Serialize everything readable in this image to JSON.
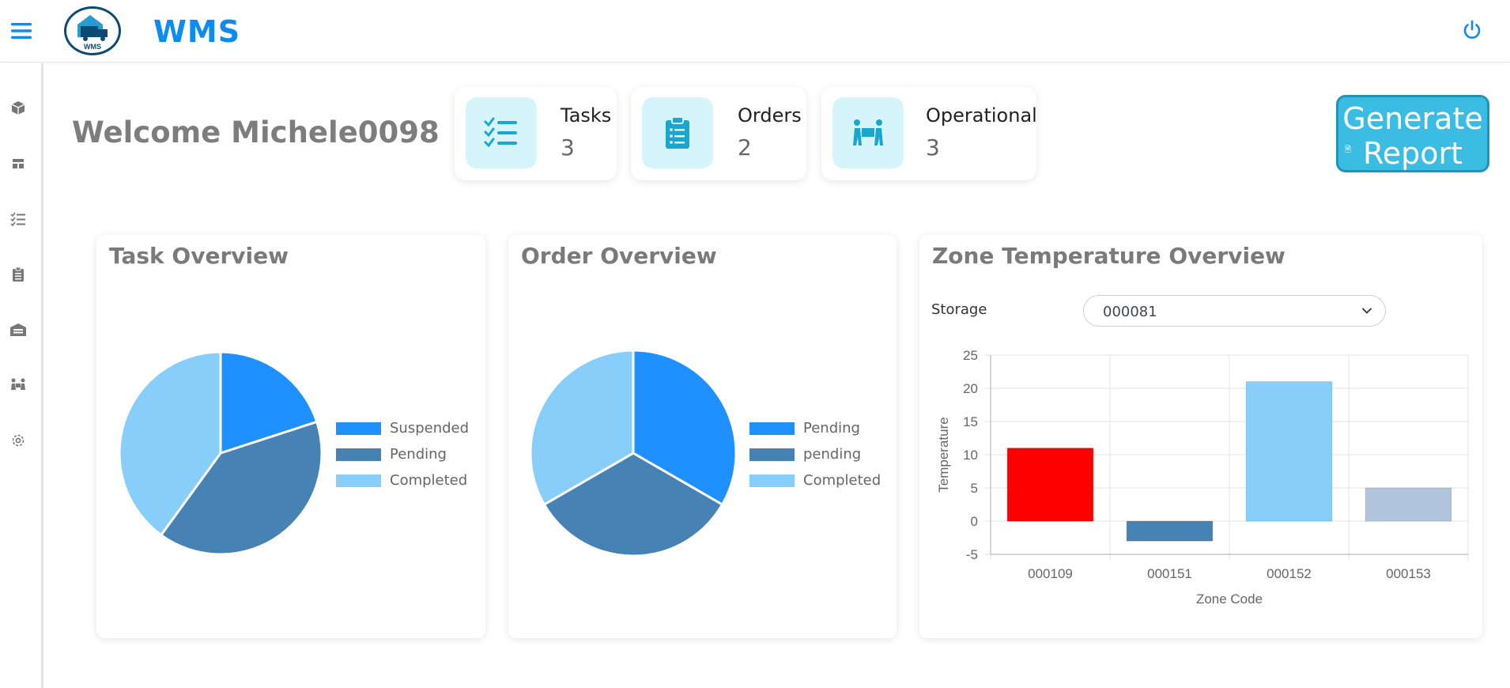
{
  "app": {
    "brand": "WMS",
    "logo_text": "WMS"
  },
  "header": {
    "menu_icon": "hamburger-icon",
    "power_icon": "power-icon",
    "accent": "#0d8bf2"
  },
  "sidebar": {
    "items": [
      {
        "icon": "box-icon"
      },
      {
        "icon": "layout-icon"
      },
      {
        "icon": "checklist-icon"
      },
      {
        "icon": "clipboard-icon"
      },
      {
        "icon": "warehouse-icon"
      },
      {
        "icon": "people-icon"
      },
      {
        "icon": "gear-icon"
      }
    ]
  },
  "welcome": "Welcome Michele0098",
  "stats": [
    {
      "label": "Tasks",
      "value": "3",
      "icon": "task-list-icon"
    },
    {
      "label": "Orders",
      "value": "2",
      "icon": "order-clipboard-icon"
    },
    {
      "label": "Operational",
      "value": "3",
      "icon": "workers-icon"
    }
  ],
  "generate_report": {
    "line1": "Generate",
    "line2": "Report"
  },
  "panels": {
    "task": {
      "title": "Task Overview"
    },
    "order": {
      "title": "Order Overview"
    },
    "zone": {
      "title": "Zone Temperature Overview",
      "storage_label": "Storage",
      "storage_value": "000081"
    }
  },
  "chart_data": [
    {
      "type": "pie",
      "title": "Task Overview",
      "labels": [
        "Suspended",
        "Pending",
        "Completed"
      ],
      "values": [
        1,
        2,
        2
      ],
      "colors": [
        "#1e90ff",
        "#4682b4",
        "#87cefa"
      ]
    },
    {
      "type": "pie",
      "title": "Order Overview",
      "labels": [
        "Pending",
        "pending",
        "Completed"
      ],
      "values": [
        1,
        1,
        1
      ],
      "colors": [
        "#1e90ff",
        "#4682b4",
        "#87cefa"
      ]
    },
    {
      "type": "bar",
      "title": "Zone Temperature Overview",
      "categories": [
        "000109",
        "000151",
        "000152",
        "000153"
      ],
      "values": [
        11,
        -3,
        21,
        5
      ],
      "colors": [
        "#ff0000",
        "#4682b4",
        "#87cefa",
        "#b0c4de"
      ],
      "xlabel": "Zone Code",
      "ylabel": "Temperature",
      "ylim": [
        -5,
        25
      ],
      "yticks": [
        -5,
        0,
        5,
        10,
        15,
        20,
        25
      ],
      "grid": true
    }
  ]
}
